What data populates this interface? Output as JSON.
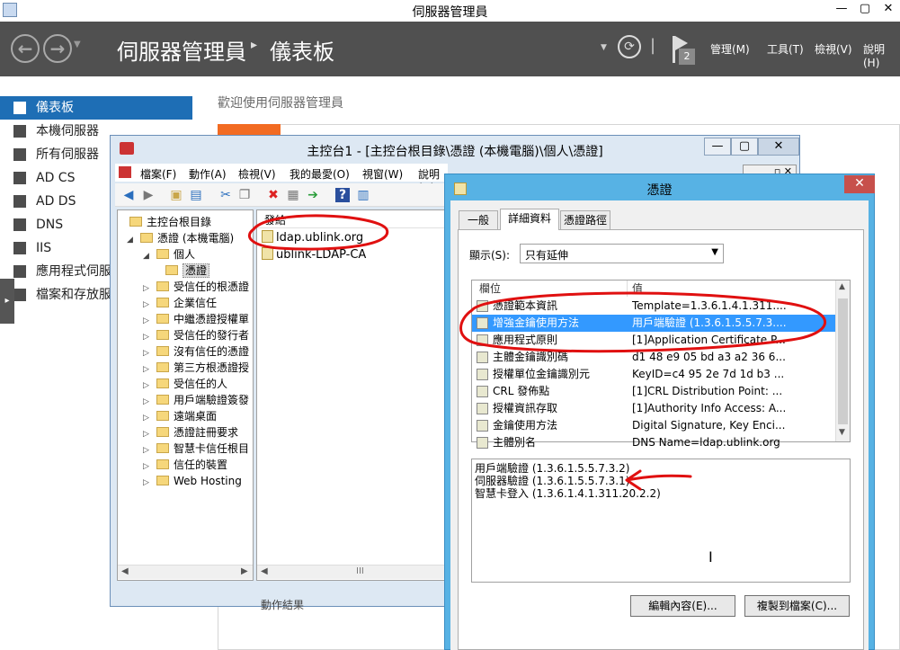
{
  "server_manager": {
    "title": "伺服器管理員",
    "breadcrumb_root": "伺服器管理員",
    "breadcrumb_page": "儀表板",
    "menu": [
      "管理(M)",
      "工具(T)",
      "檢視(V)",
      "說明(H)"
    ],
    "notification_count": "2",
    "welcome": "歡迎使用伺服器管理員",
    "sidebar": [
      {
        "label": "儀表板",
        "selected": true,
        "icon": "dashboard-icon"
      },
      {
        "label": "本機伺服器",
        "icon": "server-icon"
      },
      {
        "label": "所有伺服器",
        "icon": "servers-icon"
      },
      {
        "label": "AD CS",
        "icon": "adcs-icon"
      },
      {
        "label": "AD DS",
        "icon": "adds-icon"
      },
      {
        "label": "DNS",
        "icon": "dns-icon"
      },
      {
        "label": "IIS",
        "icon": "iis-icon"
      },
      {
        "label": "應用程式伺服",
        "icon": "appserver-icon"
      },
      {
        "label": "檔案和存放服",
        "icon": "storage-icon"
      }
    ]
  },
  "mmc": {
    "title": "主控台1 - [主控台根目錄\\憑證 (本機電腦)\\個人\\憑證]",
    "menu": [
      "檔案(F)",
      "動作(A)",
      "檢視(V)",
      "我的最愛(O)",
      "視窗(W)",
      "說明(H)"
    ],
    "tree": [
      {
        "label": "主控台根目錄",
        "level": 0
      },
      {
        "label": "憑證 (本機電腦)",
        "level": 1,
        "expanded": true
      },
      {
        "label": "個人",
        "level": 2,
        "expanded": true
      },
      {
        "label": "憑證",
        "level": 3,
        "selected": true
      },
      {
        "label": "受信任的根憑證",
        "level": 2
      },
      {
        "label": "企業信任",
        "level": 2
      },
      {
        "label": "中繼憑證授權單",
        "level": 2
      },
      {
        "label": "受信任的發行者",
        "level": 2
      },
      {
        "label": "沒有信任的憑證",
        "level": 2
      },
      {
        "label": "第三方根憑證授",
        "level": 2
      },
      {
        "label": "受信任的人",
        "level": 2
      },
      {
        "label": "用戶端驗證簽發",
        "level": 2
      },
      {
        "label": "遠端桌面",
        "level": 2
      },
      {
        "label": "憑證註冊要求",
        "level": 2
      },
      {
        "label": "智慧卡信任根目",
        "level": 2
      },
      {
        "label": "信任的裝置",
        "level": 2
      },
      {
        "label": "Web Hosting",
        "level": 2
      }
    ],
    "list_header": "發給",
    "certs": [
      "ldap.ublink.org",
      "ublink-LDAP-CA"
    ],
    "bottom_text": "動作結果"
  },
  "cert_dialog": {
    "title": "憑證",
    "tabs": [
      "一般",
      "詳細資料",
      "憑證路徑"
    ],
    "active_tab": "詳細資料",
    "show_label": "顯示(S):",
    "show_value": "只有延伸",
    "columns": [
      "欄位",
      "值"
    ],
    "fields": [
      {
        "name": "憑證範本資訊",
        "value": "Template=1.3.6.1.4.1.311...."
      },
      {
        "name": "增強金鑰使用方法",
        "value": "用戶端驗證 (1.3.6.1.5.5.7.3....",
        "selected": true
      },
      {
        "name": "應用程式原則",
        "value": "[1]Application Certificate P..."
      },
      {
        "name": "主體金鑰識別碼",
        "value": "d1 48 e9 05 bd a3 a2 36 6..."
      },
      {
        "name": "授權單位金鑰識別元",
        "value": "KeyID=c4 95 2e 7d 1d b3 ..."
      },
      {
        "name": "CRL 發佈點",
        "value": "[1]CRL Distribution Point: ..."
      },
      {
        "name": "授權資訊存取",
        "value": "[1]Authority Info Access: A..."
      },
      {
        "name": "金鑰使用方法",
        "value": "Digital Signature, Key Enci..."
      },
      {
        "name": "主體別名",
        "value": "DNS Name=ldap.ublink.org"
      }
    ],
    "details": [
      "用戶端驗證 (1.3.6.1.5.5.7.3.2)",
      "伺服器驗證 (1.3.6.1.5.5.7.3.1)",
      "智慧卡登入 (1.3.6.1.4.1.311.20.2.2)"
    ],
    "edit_button": "編輯內容(E)...",
    "copy_button": "複製到檔案(C)..."
  }
}
